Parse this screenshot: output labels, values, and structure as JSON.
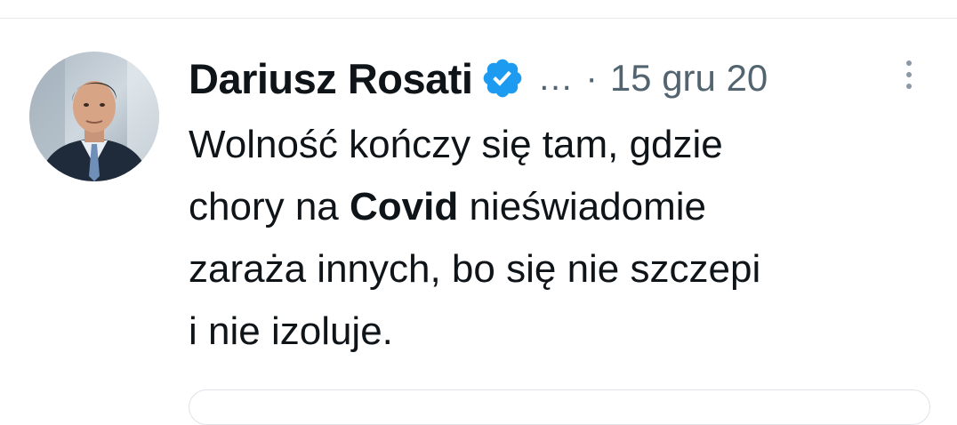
{
  "tweet": {
    "author": {
      "display_name": "Dariusz Rosati",
      "verified_icon": "verified-badge-icon",
      "truncation": "…",
      "separator": "·",
      "timestamp": "15 gru 20"
    },
    "more_icon": "more-vertical-icon",
    "text": {
      "line1": "Wolność kończy się tam, gdzie",
      "line2_before": "chory na ",
      "line2_bold": "Covid",
      "line2_after": " nieświadomie",
      "line3": "zaraża innych, bo się nie szczepi",
      "line4": "i nie izoluje."
    },
    "colors": {
      "text": "#0f1419",
      "secondary": "#536471",
      "verified_blue": "#1d9bf0",
      "divider": "#e6e9ec"
    }
  }
}
